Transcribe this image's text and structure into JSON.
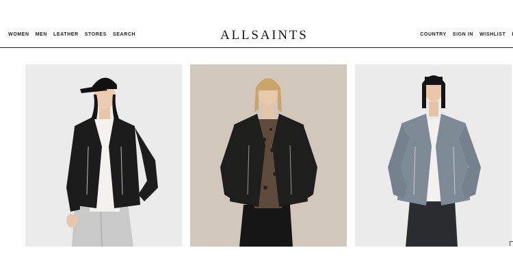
{
  "header": {
    "brand": "ALLSAINTS",
    "nav_left": [
      "WOMEN",
      "MEN",
      "LEATHER",
      "STORES",
      "SEARCH"
    ],
    "nav_right": [
      "COUNTRY",
      "SIGN IN",
      "WISHLIST",
      "B"
    ]
  },
  "products": [
    {
      "jacket_color": "#1c1c1c",
      "background": "#ebebeb"
    },
    {
      "jacket_color": "#1e1f1d",
      "background": "#d2c7bb"
    },
    {
      "jacket_color": "#7f8a97",
      "background": "#ebebeb"
    }
  ]
}
